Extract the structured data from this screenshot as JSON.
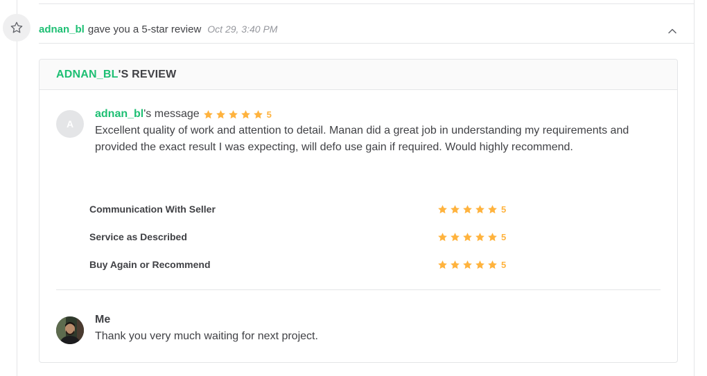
{
  "event": {
    "username": "adnan_bl",
    "action_text": "gave you a 5-star review",
    "timestamp": "Oct 29, 3:40 PM",
    "icon": "star-outline-icon",
    "collapse_icon": "chevron-up-icon"
  },
  "review": {
    "header_username": "ADNAN_BL",
    "header_suffix": "'S REVIEW",
    "avatar_letter": "A",
    "message_username": "adnan_bl",
    "message_suffix": "'s message",
    "overall_rating": 5,
    "overall_rating_label": "5",
    "message_text": "Excellent quality of work and attention to detail. Manan did a great job in understanding my requirements and provided the exact result I was expecting, will defo use gain if required. Would highly recommend.",
    "breakdown": [
      {
        "label": "Communication With Seller",
        "rating": 5,
        "rating_label": "5"
      },
      {
        "label": "Service as Described",
        "rating": 5,
        "rating_label": "5"
      },
      {
        "label": "Buy Again or Recommend",
        "rating": 5,
        "rating_label": "5"
      }
    ]
  },
  "reply": {
    "author": "Me",
    "text": "Thank you very much waiting for next project."
  },
  "colors": {
    "accent": "#1dbf73",
    "star": "#ffb33e",
    "text": "#404145",
    "muted": "#95979d",
    "border": "#e4e5e7"
  }
}
